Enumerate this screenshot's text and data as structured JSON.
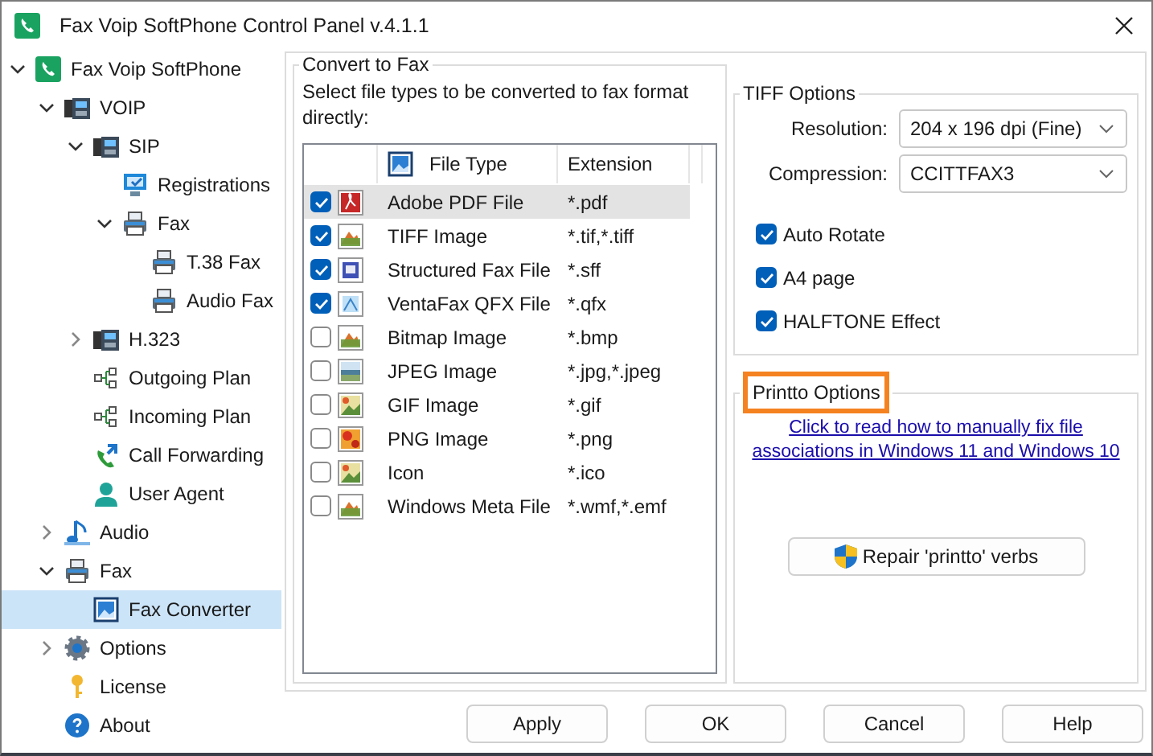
{
  "window": {
    "title": "Fax Voip SoftPhone Control Panel v.4.1.1"
  },
  "tree": [
    {
      "label": "Fax Voip SoftPhone",
      "kind": "app",
      "expanded": true,
      "selected": false,
      "children": [
        {
          "label": "VOIP",
          "kind": "desk-phone",
          "expanded": true,
          "selected": false,
          "children": [
            {
              "label": "SIP",
              "kind": "desk-phone",
              "expanded": true,
              "selected": false,
              "children": [
                {
                  "label": "Registrations",
                  "kind": "monitor",
                  "selected": false
                },
                {
                  "label": "Fax",
                  "kind": "printer",
                  "expanded": true,
                  "selected": false,
                  "children": [
                    {
                      "label": "T.38 Fax",
                      "kind": "printer",
                      "selected": false
                    },
                    {
                      "label": "Audio Fax",
                      "kind": "printer",
                      "selected": false
                    }
                  ]
                }
              ]
            },
            {
              "label": "H.323",
              "kind": "desk-phone",
              "expanded": false,
              "selected": false
            },
            {
              "label": "Outgoing Plan",
              "kind": "plan",
              "selected": false
            },
            {
              "label": "Incoming Plan",
              "kind": "plan",
              "selected": false
            },
            {
              "label": "Call Forwarding",
              "kind": "forward",
              "selected": false
            },
            {
              "label": "User Agent",
              "kind": "user",
              "selected": false
            }
          ]
        },
        {
          "label": "Audio",
          "kind": "music",
          "expanded": false,
          "selected": false
        },
        {
          "label": "Fax",
          "kind": "printer",
          "expanded": true,
          "selected": false,
          "children": [
            {
              "label": "Fax Converter",
              "kind": "image",
              "selected": true
            }
          ]
        },
        {
          "label": "Options",
          "kind": "gear",
          "expanded": false,
          "selected": false
        },
        {
          "label": "License",
          "kind": "key",
          "selected": false
        },
        {
          "label": "About",
          "kind": "help",
          "selected": false
        }
      ]
    }
  ],
  "convert": {
    "title": "Convert to Fax",
    "description": "Select file types to be converted to fax format directly:",
    "columns": [
      "File Type",
      "Extension"
    ],
    "rows": [
      {
        "file_type": "Adobe PDF File",
        "extension": "*.pdf",
        "kind": "pdf",
        "checked": true,
        "selected": true
      },
      {
        "file_type": "TIFF Image",
        "extension": "*.tif,*.tiff",
        "kind": "image",
        "checked": true,
        "selected": false
      },
      {
        "file_type": "Structured Fax File",
        "extension": "*.sff",
        "kind": "fax",
        "checked": true,
        "selected": false
      },
      {
        "file_type": "VentaFax QFX File",
        "extension": "*.qfx",
        "kind": "qfx",
        "checked": true,
        "selected": false
      },
      {
        "file_type": "Bitmap Image",
        "extension": "*.bmp",
        "kind": "image",
        "checked": false,
        "selected": false
      },
      {
        "file_type": "JPEG Image",
        "extension": "*.jpg,*.jpeg",
        "kind": "photo",
        "checked": false,
        "selected": false
      },
      {
        "file_type": "GIF Image",
        "extension": "*.gif",
        "kind": "gif",
        "checked": false,
        "selected": false
      },
      {
        "file_type": "PNG Image",
        "extension": "*.png",
        "kind": "png",
        "checked": false,
        "selected": false
      },
      {
        "file_type": "Icon",
        "extension": "*.ico",
        "kind": "gif",
        "checked": false,
        "selected": false
      },
      {
        "file_type": "Windows Meta File",
        "extension": "*.wmf,*.emf",
        "kind": "image",
        "checked": false,
        "selected": false
      }
    ]
  },
  "tiff": {
    "title": "TIFF Options",
    "fields": [
      {
        "label": "Resolution:",
        "value": "204 x 196 dpi (Fine)"
      },
      {
        "label": "Compression:",
        "value": "CCITTFAX3"
      }
    ],
    "options": [
      {
        "label": "Auto Rotate",
        "checked": true
      },
      {
        "label": "A4 page",
        "checked": true
      },
      {
        "label": "HALFTONE Effect",
        "checked": true
      }
    ]
  },
  "printto": {
    "title": "Printto Options",
    "highlighted": true,
    "link": "Click to read how to manually fix file associations in Windows 11 and Windows 10",
    "button": "Repair 'printto' verbs"
  },
  "buttons": [
    "Apply",
    "OK",
    "Cancel",
    "Help"
  ]
}
